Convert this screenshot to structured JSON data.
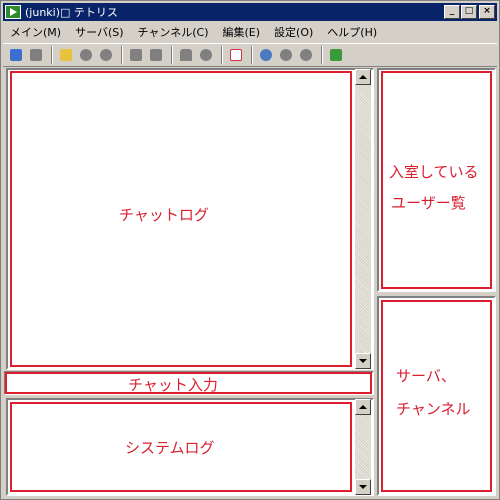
{
  "window": {
    "title": "(junki)□ テトリス",
    "minimize": "_",
    "maximize": "□",
    "close": "×"
  },
  "menu": [
    "メイン(M)",
    "サーバ(S)",
    "チャンネル(C)",
    "編集(E)",
    "設定(O)",
    "ヘルプ(H)"
  ],
  "toolbar": {
    "icons": [
      "connect-icon",
      "disconnect-icon",
      "folder-icon",
      "channel-icon",
      "channel-part-icon",
      "message-icon",
      "private-message-icon",
      "lock-icon",
      "mode-icon",
      "checklist-icon",
      "search-icon",
      "whois-icon",
      "user-icon",
      "exit-icon"
    ],
    "colors": {
      "connect": "#3a6fd0",
      "folder": "#e8c23a",
      "generic": "#808080",
      "checklist": "#cc3344",
      "search": "#4a7bbf",
      "exit": "#3a9a3a"
    }
  },
  "labels": {
    "chat_log": "チャットログ",
    "chat_input": "チャット入力",
    "system_log": "システムログ",
    "user_list_line1": "入室している",
    "user_list_line2": "ユーザー覧",
    "server_line1": "サーバ、",
    "server_line2": "チャンネル"
  },
  "accent": "#dd1e2f"
}
